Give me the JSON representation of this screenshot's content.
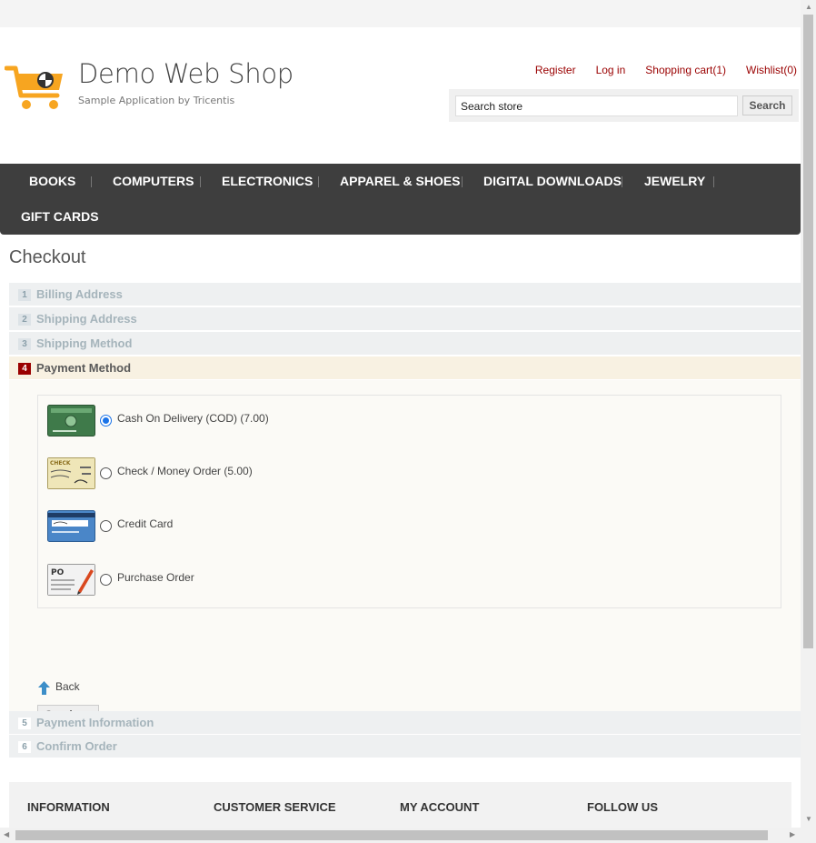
{
  "brand": {
    "title": "Demo Web Shop",
    "subtitle": "Sample Application by Tricentis"
  },
  "header_links": [
    "Register",
    "Log in",
    "Shopping cart(1)",
    "Wishlist(0)"
  ],
  "search": {
    "placeholder": "Search store",
    "value": "Search store",
    "button": "Search"
  },
  "menu": [
    "BOOKS",
    "COMPUTERS",
    "ELECTRONICS",
    "APPAREL & SHOES",
    "DIGITAL DOWNLOADS",
    "JEWELRY",
    "GIFT CARDS"
  ],
  "checkout": {
    "title": "Checkout",
    "steps": [
      {
        "num": "1",
        "label": "Billing Address"
      },
      {
        "num": "2",
        "label": "Shipping Address"
      },
      {
        "num": "3",
        "label": "Shipping Method"
      },
      {
        "num": "4",
        "label": "Payment Method"
      },
      {
        "num": "5",
        "label": "Payment Information"
      },
      {
        "num": "6",
        "label": "Confirm Order"
      }
    ],
    "active_step": "4",
    "payment_methods": [
      {
        "label": "Cash On Delivery (COD) (7.00)",
        "icon": "cod-card-icon",
        "selected": true
      },
      {
        "label": "Check / Money Order (5.00)",
        "icon": "check-icon",
        "selected": false
      },
      {
        "label": "Credit Card",
        "icon": "credit-card-icon",
        "selected": false
      },
      {
        "label": "Purchase Order",
        "icon": "purchase-order-icon",
        "selected": false
      }
    ],
    "check_img_text": "CHECK",
    "po_img_text": "PO",
    "back_label": "Back",
    "continue_label": "Continue"
  },
  "footer": {
    "headings": [
      "INFORMATION",
      "CUSTOMER SERVICE",
      "MY ACCOUNT",
      "FOLLOW US"
    ]
  },
  "colors": {
    "link": "#9a0000",
    "menu_bg": "#3e3e3e",
    "accent_orange": "#f7a520"
  }
}
